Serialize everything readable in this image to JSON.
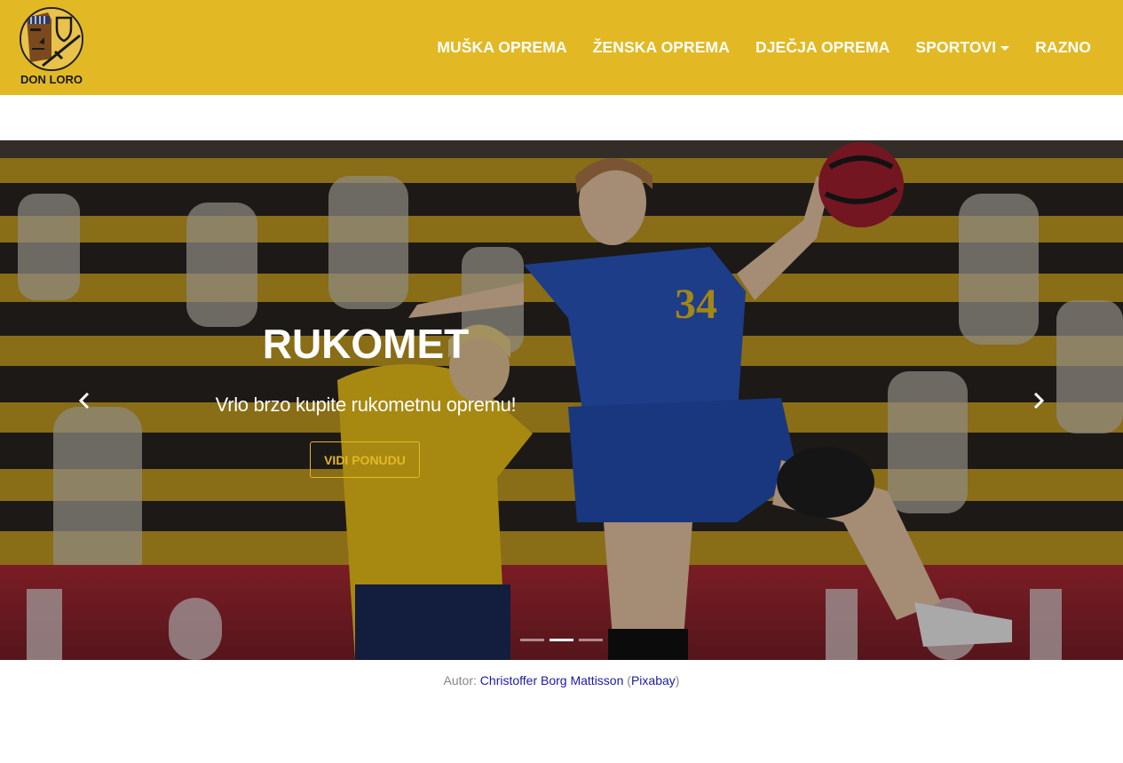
{
  "brand": {
    "name": "DON LORO",
    "logo_icon": "knight-shield-sword-icon"
  },
  "nav": {
    "items": [
      {
        "label": "MUŠKA OPREMA"
      },
      {
        "label": "ŽENSKA OPREMA"
      },
      {
        "label": "DJEČJA OPREMA"
      },
      {
        "label": "SPORTOVI",
        "dropdown": true
      },
      {
        "label": "RAZNO"
      }
    ]
  },
  "carousel": {
    "slide_count": 3,
    "active_index": 1,
    "caption": {
      "title": "RUKOMET",
      "text": "Vrlo brzo kupite rukometnu opremu!",
      "button_label": "VIDI PONUDU"
    },
    "prev_icon": "chevron-left-icon",
    "next_icon": "chevron-right-icon"
  },
  "credit": {
    "prefix": "Autor: ",
    "author": "Christoffer Borg Mattisson",
    "open_paren": " (",
    "source": "Pixabay",
    "close_paren": ")"
  },
  "colors": {
    "brand_yellow": "#e2b925",
    "nav_text": "#ffffff",
    "link_blue": "#1a1aa8",
    "muted_text": "#868686"
  }
}
